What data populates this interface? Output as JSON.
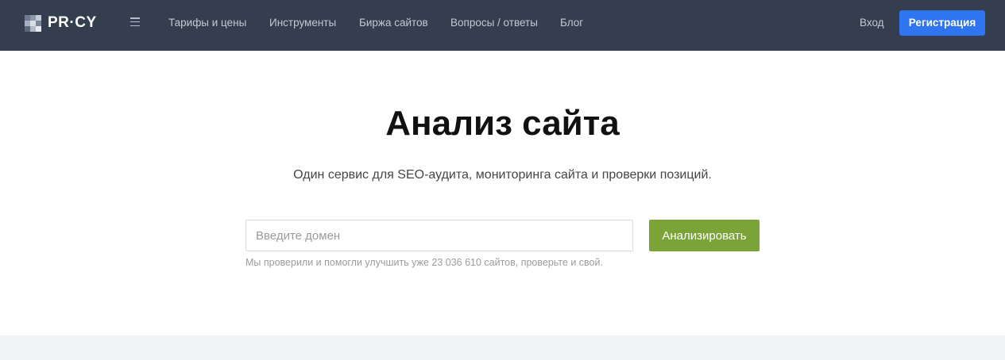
{
  "header": {
    "logo_text": "PR·CY",
    "nav": [
      {
        "label": "Тарифы и цены"
      },
      {
        "label": "Инструменты"
      },
      {
        "label": "Биржа сайтов"
      },
      {
        "label": "Вопросы / ответы"
      },
      {
        "label": "Блог"
      }
    ],
    "login_label": "Вход",
    "register_label": "Регистрация"
  },
  "hero": {
    "title": "Анализ сайта",
    "subtitle": "Один сервис для SEO-аудита, мониторинга сайта и проверки позиций.",
    "input_placeholder": "Введите домен",
    "input_value": "",
    "analyze_label": "Анализировать",
    "hint": "Мы проверили и помогли улучшить уже 23 036 610 сайтов, проверьте и свой."
  },
  "colors": {
    "header_bg": "#343e4e",
    "register_button": "#2f74f1",
    "analyze_button": "#7aa437"
  },
  "icons": {
    "logo": "pixel-grid-logo-icon",
    "menu": "hamburger-menu-icon"
  }
}
